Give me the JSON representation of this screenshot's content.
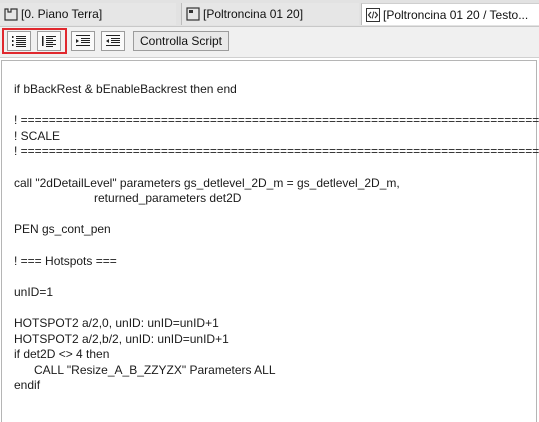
{
  "tabs": [
    {
      "label": "[0. Piano Terra]",
      "icon": "floor-plan-icon",
      "active": false
    },
    {
      "label": "[Poltroncina 01 20]",
      "icon": "object-editor-icon",
      "active": false
    },
    {
      "label": "[Poltroncina 01 20 / Testo...",
      "icon": "script-code-icon",
      "active": true
    }
  ],
  "toolbar": {
    "buttons": [
      {
        "icon": "indent-list-icon"
      },
      {
        "icon": "outdent-list-icon"
      },
      {
        "icon": "indent-right-icon"
      },
      {
        "icon": "outdent-left-icon"
      }
    ],
    "check_script_label": "Controlla Script",
    "highlight_color": "#e0282e"
  },
  "editor": {
    "lines": [
      "if bBackRest & bEnableBackrest then end",
      "",
      "! ============================================================================",
      "! SCALE",
      "! ============================================================================",
      "",
      "call \"2dDetailLevel\" parameters gs_detlevel_2D_m = gs_detlevel_2D_m,",
      "                        returned_parameters det2D",
      "",
      "PEN gs_cont_pen",
      "",
      "! === Hotspots ===",
      "",
      "unID=1",
      "",
      "HOTSPOT2 a/2,0, unID: unID=unID+1",
      "HOTSPOT2 a/2,b/2, unID: unID=unID+1",
      "if det2D <> 4 then",
      "      CALL \"Resize_A_B_ZZYZX\" Parameters ALL",
      "endif"
    ]
  }
}
